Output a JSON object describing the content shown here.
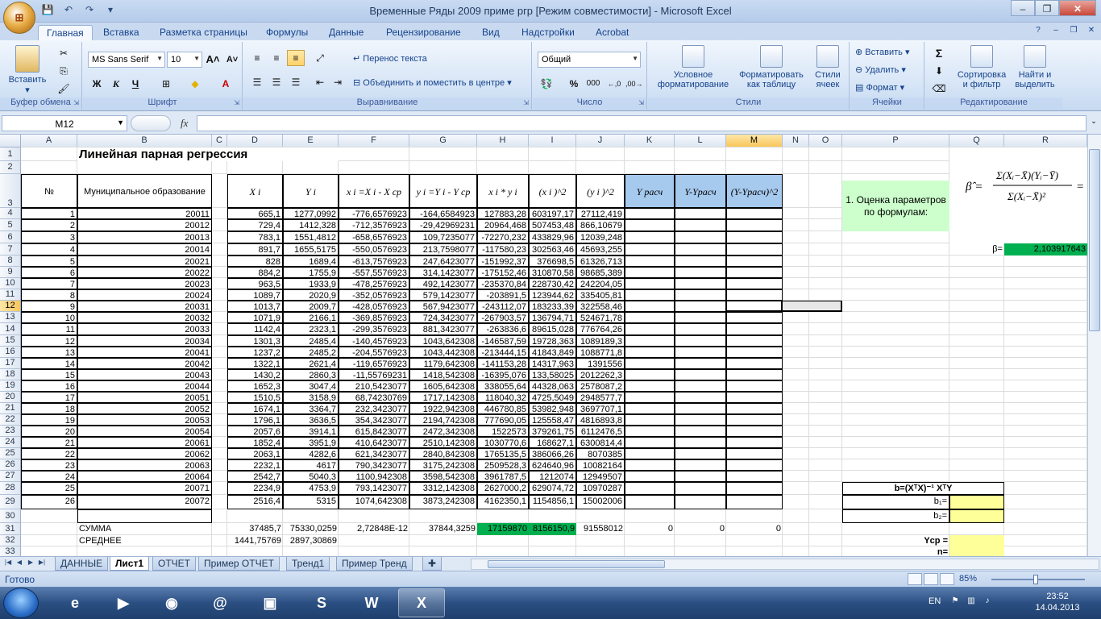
{
  "window": {
    "title": "Временные Ряды 2009 приме ргр  [Режим совместимости] - Microsoft Excel",
    "office_button": "⊞"
  },
  "ribbon_tabs": [
    "Главная",
    "Вставка",
    "Разметка страницы",
    "Формулы",
    "Данные",
    "Рецензирование",
    "Вид",
    "Надстройки",
    "Acrobat"
  ],
  "ribbon": {
    "clipboard": {
      "paste": "Вставить",
      "label": "Буфер обмена"
    },
    "font": {
      "name": "MS Sans Serif",
      "size": "10",
      "label": "Шрифт",
      "bold": "Ж",
      "italic": "К",
      "underline": "Ч"
    },
    "alignment": {
      "wrap": "Перенос текста",
      "merge": "Объединить и поместить в центре",
      "label": "Выравнивание"
    },
    "number": {
      "format": "Общий",
      "label": "Число",
      "percent": "%",
      "thousands": "000"
    },
    "styles": {
      "conditional": "Условное форматирование",
      "table": "Форматировать как таблицу",
      "cell": "Стили ячеек",
      "label": "Стили"
    },
    "cells": {
      "insert": "Вставить",
      "delete": "Удалить",
      "format": "Формат",
      "label": "Ячейки"
    },
    "editing": {
      "sum": "Σ",
      "sort": "Сортировка и фильтр",
      "find": "Найти и выделить",
      "label": "Редактирование"
    }
  },
  "formula_bar": {
    "name_box": "M12",
    "fx": "fx",
    "value": ""
  },
  "columns": [
    "A",
    "B",
    "C",
    "D",
    "E",
    "F",
    "G",
    "H",
    "I",
    "J",
    "K",
    "L",
    "M",
    "N",
    "O",
    "P",
    "Q",
    "R"
  ],
  "rows": [
    "1",
    "2",
    "3",
    "4",
    "5",
    "6",
    "7",
    "8",
    "9",
    "10",
    "11",
    "12",
    "13",
    "14",
    "15",
    "16",
    "17",
    "18",
    "19",
    "20",
    "21",
    "22",
    "23",
    "24",
    "25",
    "26",
    "27",
    "28",
    "29",
    "30",
    "31",
    "32",
    "33"
  ],
  "sheet": {
    "title": "Линейная парная регрессия",
    "headers": {
      "num": "№",
      "mun": "Муниципальное образование",
      "xi": "X i",
      "yi": "Y i",
      "xdev": "x i =X i - X ср",
      "ydev": "y i =Y i - Y ср",
      "xy": "x i * y i",
      "x2": "(x i )^2",
      "y2": "(y i )^2",
      "yrasch": "Y расч",
      "ydiff": "Y-Yрасч",
      "ydiff2": "(Y-Yрасч)^2"
    },
    "data": [
      [
        "1",
        "20011",
        "665,1",
        "1277,0992",
        "-776,6576923",
        "-164,6584923",
        "127883,28",
        "603197,17",
        "27112,419"
      ],
      [
        "2",
        "20012",
        "729,4",
        "1412,328",
        "-712,3576923",
        "-29,42969231",
        "20964,468",
        "507453,48",
        "866,10679"
      ],
      [
        "3",
        "20013",
        "783,1",
        "1551,4812",
        "-658,6576923",
        "109,7235077",
        "-72270,232",
        "433829,96",
        "12039,248"
      ],
      [
        "4",
        "20014",
        "891,7",
        "1655,5175",
        "-550,0576923",
        "213,7598077",
        "-117580,23",
        "302563,46",
        "45693,255"
      ],
      [
        "5",
        "20021",
        "828",
        "1689,4",
        "-613,7576923",
        "247,6423077",
        "-151992,37",
        "376698,5",
        "61326,713"
      ],
      [
        "6",
        "20022",
        "884,2",
        "1755,9",
        "-557,5576923",
        "314,1423077",
        "-175152,46",
        "310870,58",
        "98685,389"
      ],
      [
        "7",
        "20023",
        "963,5",
        "1933,9",
        "-478,2576923",
        "492,1423077",
        "-235370,84",
        "228730,42",
        "242204,05"
      ],
      [
        "8",
        "20024",
        "1089,7",
        "2020,9",
        "-352,0576923",
        "579,1423077",
        "-203891,5",
        "123944,62",
        "335405,81"
      ],
      [
        "9",
        "20031",
        "1013,7",
        "2009,7",
        "-428,0576923",
        "567,9423077",
        "-243112,07",
        "183233,39",
        "322558,46"
      ],
      [
        "10",
        "20032",
        "1071,9",
        "2166,1",
        "-369,8576923",
        "724,3423077",
        "-267903,57",
        "136794,71",
        "524671,78"
      ],
      [
        "11",
        "20033",
        "1142,4",
        "2323,1",
        "-299,3576923",
        "881,3423077",
        "-263836,6",
        "89615,028",
        "776764,26"
      ],
      [
        "12",
        "20034",
        "1301,3",
        "2485,4",
        "-140,4576923",
        "1043,642308",
        "-146587,59",
        "19728,363",
        "1089189,3"
      ],
      [
        "13",
        "20041",
        "1237,2",
        "2485,2",
        "-204,5576923",
        "1043,442308",
        "-213444,15",
        "41843,849",
        "1088771,8"
      ],
      [
        "14",
        "20042",
        "1322,1",
        "2621,4",
        "-119,6576923",
        "1179,642308",
        "-141153,28",
        "14317,963",
        "1391556"
      ],
      [
        "15",
        "20043",
        "1430,2",
        "2860,3",
        "-11,55769231",
        "1418,542308",
        "-16395,076",
        "133,58025",
        "2012262,3"
      ],
      [
        "16",
        "20044",
        "1652,3",
        "3047,4",
        "210,5423077",
        "1605,642308",
        "338055,64",
        "44328,063",
        "2578087,2"
      ],
      [
        "17",
        "20051",
        "1510,5",
        "3158,9",
        "68,74230769",
        "1717,142308",
        "118040,32",
        "4725,5049",
        "2948577,7"
      ],
      [
        "18",
        "20052",
        "1674,1",
        "3364,7",
        "232,3423077",
        "1922,942308",
        "446780,85",
        "53982,948",
        "3697707,1"
      ],
      [
        "19",
        "20053",
        "1796,1",
        "3636,5",
        "354,3423077",
        "2194,742308",
        "777690,05",
        "125558,47",
        "4816893,8"
      ],
      [
        "20",
        "20054",
        "2057,6",
        "3914,1",
        "615,8423077",
        "2472,342308",
        "1522573",
        "379261,75",
        "6112476,5"
      ],
      [
        "21",
        "20061",
        "1852,4",
        "3951,9",
        "410,6423077",
        "2510,142308",
        "1030770,6",
        "168627,1",
        "6300814,4"
      ],
      [
        "22",
        "20062",
        "2063,1",
        "4282,6",
        "621,3423077",
        "2840,842308",
        "1765135,5",
        "386066,26",
        "8070385"
      ],
      [
        "23",
        "20063",
        "2232,1",
        "4617",
        "790,3423077",
        "3175,242308",
        "2509528,3",
        "624640,96",
        "10082164"
      ],
      [
        "24",
        "20064",
        "2542,7",
        "5040,3",
        "1100,942308",
        "3598,542308",
        "3961787,5",
        "1212074",
        "12949507"
      ],
      [
        "25",
        "20071",
        "2234,9",
        "4753,9",
        "793,1423077",
        "3312,142308",
        "2627000,2",
        "629074,72",
        "10970287"
      ],
      [
        "26",
        "20072",
        "2516,4",
        "5315",
        "1074,642308",
        "3873,242308",
        "4162350,1",
        "1154856,1",
        "15002006"
      ]
    ],
    "sum_label": "СУММА",
    "sum": [
      "37485,7",
      "75330,0259",
      "2,72848E-12",
      "37844,3259",
      "17159870",
      "8156150,9",
      "91558012",
      "0",
      "0",
      "0"
    ],
    "avg_label": "СРЕДНЕЕ",
    "avg": [
      "1441,75769",
      "2897,30869"
    ],
    "side": {
      "estimate": "1. Оценка параметров по формулам:",
      "beta_label": "β=",
      "beta_value": "2,103917643",
      "matrix": "b=(XᵀX)⁻¹ XᵀY",
      "b1": "b₁=",
      "b2": "b₂=",
      "ycp": "Yср =",
      "n": "n="
    }
  },
  "sheet_tabs": [
    "ДАННЫЕ",
    "Лист1",
    "ОТЧЕТ",
    "Пример ОТЧЕТ",
    "Тренд1",
    "Пример Тренд"
  ],
  "status": {
    "ready": "Готово",
    "zoom": "85%"
  },
  "taskbar": {
    "lang": "EN",
    "time": "23:52",
    "date": "14.04.2013"
  }
}
